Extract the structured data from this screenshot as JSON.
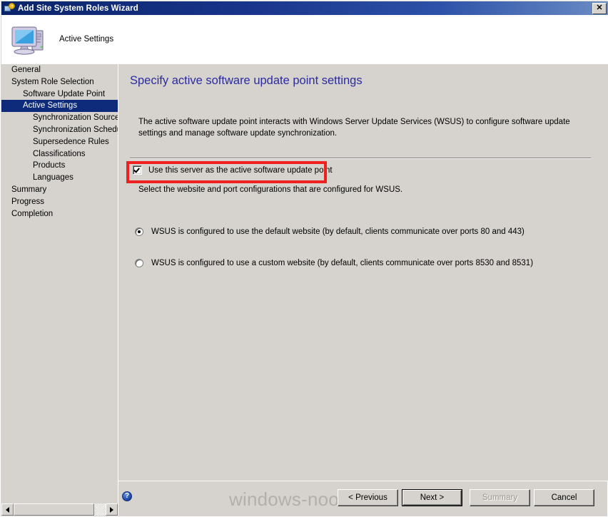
{
  "window": {
    "title": "Add Site System Roles Wizard",
    "close_label": "✕",
    "title_icon": "computer-gear-icon"
  },
  "header": {
    "title": "Active Settings",
    "icon": "computer-icon"
  },
  "sidebar": {
    "items": [
      {
        "label": "General",
        "level": 1,
        "selected": false
      },
      {
        "label": "System Role Selection",
        "level": 1,
        "selected": false
      },
      {
        "label": "Software Update Point",
        "level": 2,
        "selected": false
      },
      {
        "label": "Active Settings",
        "level": 2,
        "selected": true
      },
      {
        "label": "Synchronization Source",
        "level": 3,
        "selected": false
      },
      {
        "label": "Synchronization Schedule",
        "level": 3,
        "selected": false
      },
      {
        "label": "Supersedence Rules",
        "level": 3,
        "selected": false
      },
      {
        "label": "Classifications",
        "level": 3,
        "selected": false
      },
      {
        "label": "Products",
        "level": 3,
        "selected": false
      },
      {
        "label": "Languages",
        "level": 3,
        "selected": false
      },
      {
        "label": "Summary",
        "level": 1,
        "selected": false
      },
      {
        "label": "Progress",
        "level": 1,
        "selected": false
      },
      {
        "label": "Completion",
        "level": 1,
        "selected": false
      }
    ],
    "scrollbar": {
      "left_arrow": "scroll-left-icon",
      "right_arrow": "scroll-right-icon"
    }
  },
  "main": {
    "heading": "Specify active software update point settings",
    "intro": "The active software update point interacts with Windows Server Update Services (WSUS) to configure software update settings and manage software update synchronization.",
    "checkbox": {
      "label": "Use this server as the active software update point",
      "checked": true,
      "highlighted": true,
      "highlight_color": "#ef2020"
    },
    "sub_text": "Select the website and port configurations that are configured for WSUS.",
    "radio_group": {
      "options": [
        {
          "label": "WSUS is configured to use the default website (by default, clients communicate over ports 80 and 443)",
          "selected": true
        },
        {
          "label": "WSUS is configured to use a custom website (by default, clients communicate over ports 8530 and 8531)",
          "selected": false
        }
      ]
    }
  },
  "footer": {
    "help_icon": "help-icon",
    "help_glyph": "?",
    "buttons": [
      {
        "label": "< Previous",
        "state": "enabled"
      },
      {
        "label": "Next >",
        "state": "default"
      },
      {
        "label": "Summary",
        "state": "disabled"
      },
      {
        "label": "Cancel",
        "state": "enabled"
      }
    ]
  },
  "watermark": {
    "text": "windows-noob.com"
  },
  "colors": {
    "titlebar_start": "#0a246a",
    "titlebar_end": "#6a8cc4",
    "panel_bg": "#d6d3ce",
    "heading_text": "#2b2b9e",
    "selection_bg": "#0d2b7a",
    "highlight_red": "#ef2020",
    "watermark_gray": "#b3b0ab"
  }
}
